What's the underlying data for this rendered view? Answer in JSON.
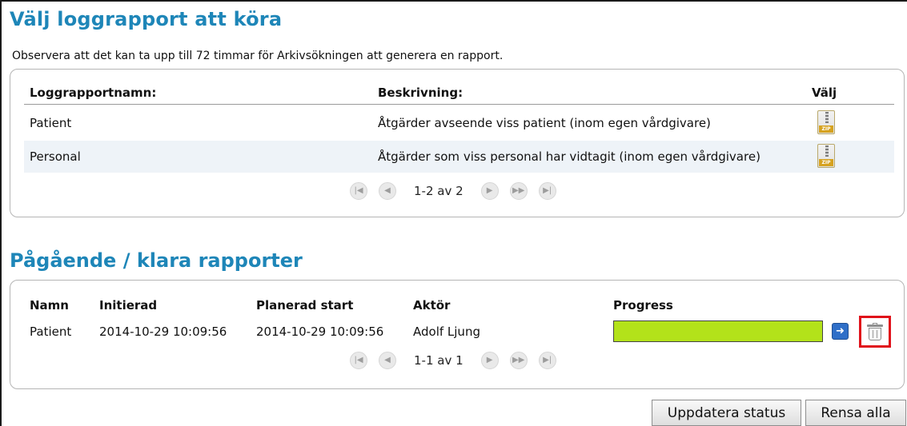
{
  "report_section": {
    "title": "Välj loggrapport att köra",
    "note": "Observera att det kan ta upp till 72 timmar för Arkivsökningen att generera en rapport.",
    "columns": {
      "name": "Loggrapportnamn:",
      "description": "Beskrivning:",
      "select": "Välj"
    },
    "rows": [
      {
        "name": "Patient",
        "description": "Åtgärder avseende viss patient (inom egen vårdgivare)",
        "icon": "zip-file-icon"
      },
      {
        "name": "Personal",
        "description": "Åtgärder som viss personal har vidtagit (inom egen vårdgivare)",
        "icon": "zip-file-icon"
      }
    ],
    "pager": {
      "text": "1-2 av 2",
      "zip_label": "ZIP"
    }
  },
  "status_section": {
    "title": "Pågående / klara rapporter",
    "columns": {
      "name": "Namn",
      "initiated": "Initierad",
      "planned_start": "Planerad start",
      "actor": "Aktör",
      "progress": "Progress"
    },
    "rows": [
      {
        "name": "Patient",
        "initiated": "2014-10-29 10:09:56",
        "planned_start": "2014-10-29 10:09:56",
        "actor": "Adolf Ljung",
        "progress_fraction": 1.0
      }
    ],
    "pager": {
      "text": "1-1 av 1"
    }
  },
  "buttons": {
    "update_status": "Uppdatera status",
    "clear_all": "Rensa alla"
  },
  "colors": {
    "heading": "#1e86b8",
    "progress_fill": "#b3e21a",
    "highlight": "#e0101a",
    "go_button": "#2f6fc8"
  }
}
